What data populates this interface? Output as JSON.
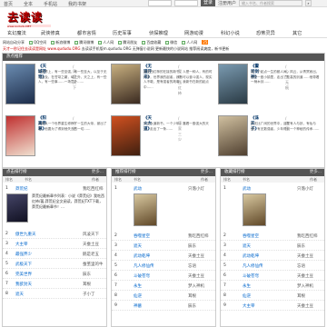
{
  "topbar": {
    "links": [
      "首页",
      "全本",
      "手机站",
      "我的书架"
    ],
    "username_label": "",
    "password_label": "",
    "login_label": "登录",
    "register_label": "注册用户",
    "search_placeholder": "输入书名、作者搜索",
    "search_icon": "search-icon"
  },
  "logo": {
    "text": "去读读",
    "subtitle": "www.qududu.NET"
  },
  "nav": [
    "玄幻魔法",
    "武侠修真",
    "都市言情",
    "历史军事",
    "侦探推理",
    "网游动漫",
    "科幻小说",
    "恐怖灵异",
    "其它"
  ],
  "ticker": {
    "items": [
      "网站自动分享",
      "QQ空间",
      "新浪微博",
      "腾讯微博",
      "人人网",
      "腾讯朋友",
      "百度收藏",
      "微信",
      "人人网"
    ],
    "count": "25",
    "notice_prefix": "亲爱的",
    "notice": "天才一秒记住去读读是网址 www.qududu.ORG 去读读手机版m.qududu.ORG 无弹窗小说网 更新最快的小说网站 推荐阅读爽度，新书更新！",
    "notice_red": "天才一秒记住去读读是网址 www.qududu.ORG",
    "notice_rest": "去读读手机版m.qududu.ORG 无弹窗小说网 更新最快的小说网站 推荐阅读爽度，新书更新"
  },
  "hot": {
    "title": "热点推荐",
    "books": [
      {
        "title": "《天域苍穹》",
        "author": "/ 风凌天下",
        "desc": "这世界上，有一些至强，有一些至大，以至于无法企及。在苍穹之巅，域之外，天之上，有一些人，有一些事……一场意外……",
        "color1": "#6a8bb0",
        "color2": "#1d2d4a"
      },
      {
        "title": "《无道开来》",
        "author": "/ 我吃西红柿",
        "desc": "我吃西红柿的在接的新书，人是一种人，有的时代中，世界我的起者，我有可以奋斗强人，现实人不敢，是有强者的故事，我新书在新的起点中……",
        "color1": "#c8b080",
        "color2": "#3a2a20"
      },
      {
        "title": "《霍司剑神》",
        "author": "/ 心梦无痕",
        "desc": "这一个起点一生的都人间，风云，从青冥而出，谁在一座小镇里，走出了至高的剑道……他带着一柄木剑……",
        "color1": "#7a9ab0",
        "color2": "#2a3a44"
      },
      {
        "title": "《阳离帝尊》",
        "author": "/ 寺逆",
        "desc": "当初从一个世界重生修炼了一生的大帝，被出了后，他要为了得到他失去的一切……",
        "color1": "#c03030",
        "color2": "#f0e0d0"
      },
      {
        "title": "《天火大道》",
        "author": "/ 唐家三少",
        "desc": "天火大道新书，一个少年，靠着一股强大的天火，走出了一条……",
        "color1": "#d05020",
        "color2": "#402010"
      },
      {
        "title": "《诛天子》",
        "author": "/ 赤玉",
        "desc": "在无比广阔的世界中，这里有人与妖，有仙与魔，有无数强者，少年得到一个神秘的传承……",
        "color1": "#d0c0a0",
        "color2": "#504030"
      }
    ]
  },
  "panels": [
    {
      "title": "点击排行榜",
      "more": "更多...",
      "headers": [
        "排名",
        "书名",
        "作者"
      ],
      "feat_title": "莽荒纪",
      "feat_author": "我吃西红柿",
      "feat_desc": "莽荒纪最新章节列表：小说《莽荒纪》我吃西红柿/著,莽荒纪全文阅读，莽荒纪TXT下载，莽荒纪最新章节！…",
      "rows": [
        {
          "num": "1",
          "title": "莽荒纪",
          "author": "我吃西红柿"
        },
        {
          "num": "2",
          "title": "傲世九重天",
          "author": "风凌天下"
        },
        {
          "num": "3",
          "title": "大主宰",
          "author": "天蚕土豆"
        },
        {
          "num": "4",
          "title": "最强弃少",
          "author": "鹅是老五"
        },
        {
          "num": "5",
          "title": "武极天下",
          "author": "蚕茧里的牛"
        },
        {
          "num": "6",
          "title": "完美世界",
          "author": "辰东"
        },
        {
          "num": "7",
          "title": "我欲封天",
          "author": "耳根"
        },
        {
          "num": "8",
          "title": "遮天",
          "author": "子小丁"
        }
      ]
    },
    {
      "title": "推荐排行榜",
      "more": "更多...",
      "headers": [
        "排名",
        "书名",
        "作者"
      ],
      "feat_title": "武动乾坤",
      "feat_author": "天蚕土豆",
      "rows": [
        {
          "num": "1",
          "title": "武动",
          "author": "只落小灯"
        },
        {
          "num": "2",
          "title": "吞噬星空",
          "author": "我吃西红柿"
        },
        {
          "num": "3",
          "title": "遮天",
          "author": "辰东"
        },
        {
          "num": "4",
          "title": "武动乾坤",
          "author": "天蚕土豆"
        },
        {
          "num": "5",
          "title": "凡人修仙传",
          "author": "忘语"
        },
        {
          "num": "6",
          "title": "斗破苍穹",
          "author": "天蚕土豆"
        },
        {
          "num": "7",
          "title": "永生",
          "author": "梦入神机"
        },
        {
          "num": "8",
          "title": "仙逆",
          "author": "耳根"
        },
        {
          "num": "9",
          "title": "神墓",
          "author": "辰东"
        }
      ]
    },
    {
      "title": "收藏排行榜",
      "more": "更多...",
      "headers": [
        "排名",
        "书名",
        "作者"
      ],
      "feat_title": "武动",
      "feat_author": "只落小灯",
      "rows": [
        {
          "num": "1",
          "title": "武动",
          "author": "只落小灯"
        },
        {
          "num": "2",
          "title": "吞噬星空",
          "author": "我吃西红柿"
        },
        {
          "num": "3",
          "title": "遮天",
          "author": "辰东"
        },
        {
          "num": "4",
          "title": "武动乾坤",
          "author": "天蚕土豆"
        },
        {
          "num": "5",
          "title": "凡人修仙传",
          "author": "忘语"
        },
        {
          "num": "6",
          "title": "斗破苍穹",
          "author": "天蚕土豆"
        },
        {
          "num": "7",
          "title": "永生",
          "author": "梦入神机"
        },
        {
          "num": "8",
          "title": "仙逆",
          "author": "耳根"
        },
        {
          "num": "9",
          "title": "大主宰",
          "author": "天蚕土豆"
        }
      ]
    }
  ]
}
